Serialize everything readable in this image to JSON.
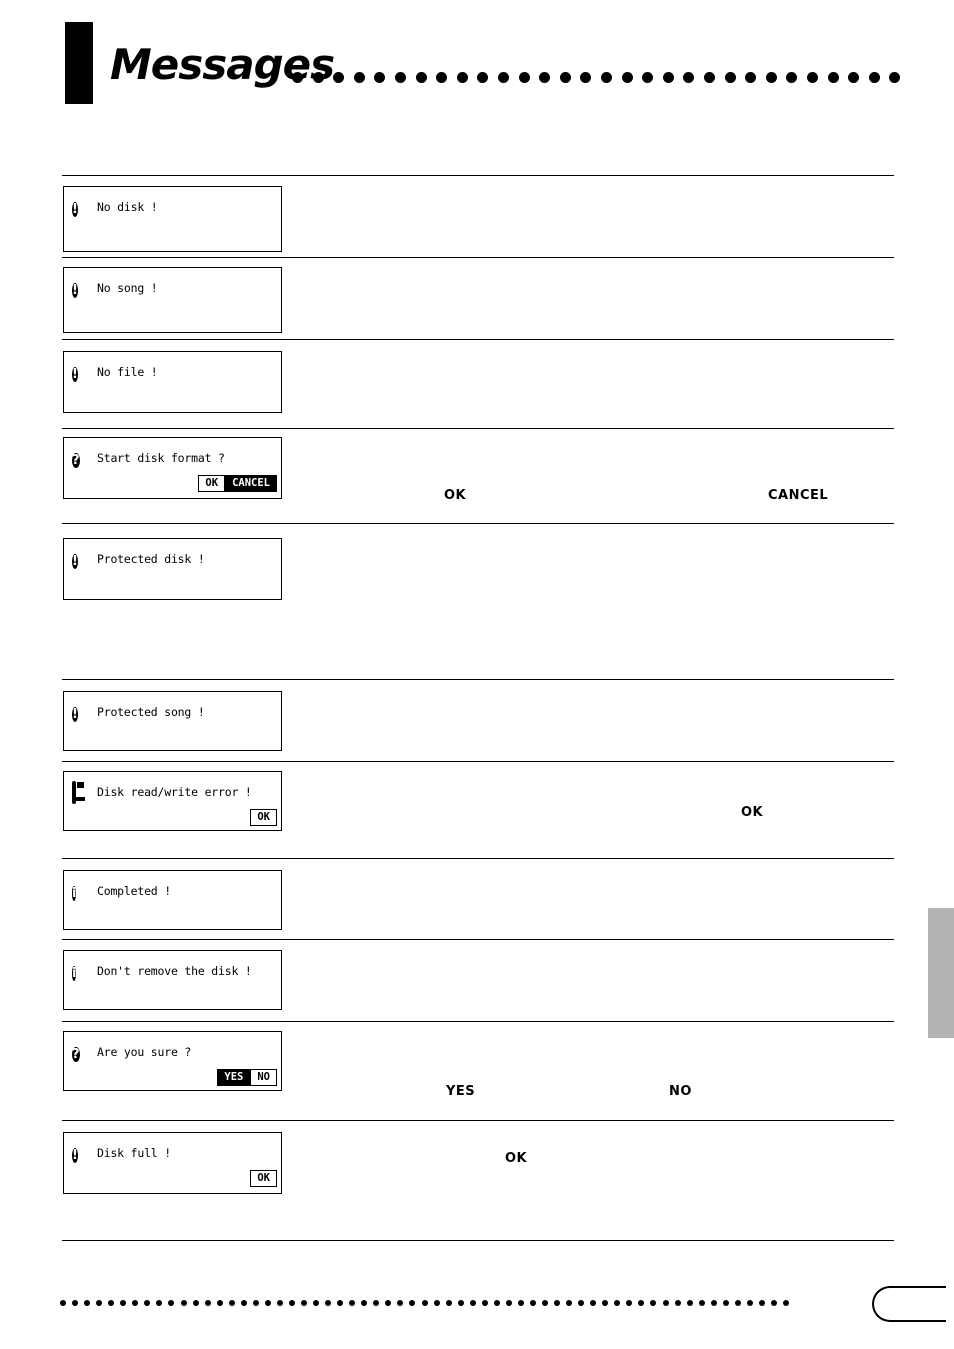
{
  "header": {
    "title": "Messages",
    "dot_count": 30
  },
  "messages": [
    {
      "id": "no-disk",
      "icon": "exclamation-icon",
      "icon_glyph": "!",
      "text": "No disk !",
      "buttons": []
    },
    {
      "id": "no-song",
      "icon": "exclamation-icon",
      "icon_glyph": "!",
      "text": "No song !",
      "buttons": []
    },
    {
      "id": "no-file",
      "icon": "exclamation-icon",
      "icon_glyph": "!",
      "text": "No file !",
      "buttons": []
    },
    {
      "id": "start-disk-format",
      "icon": "question-icon",
      "icon_glyph": "?",
      "text": "Start disk format ?",
      "buttons": [
        {
          "label": "OK",
          "inverted": false
        },
        {
          "label": "CANCEL",
          "inverted": true
        }
      ]
    },
    {
      "id": "protected-disk",
      "icon": "exclamation-icon",
      "icon_glyph": "!",
      "text": "Protected disk !",
      "buttons": []
    },
    {
      "id": "protected-song",
      "icon": "exclamation-icon",
      "icon_glyph": "!",
      "text": "Protected song !",
      "buttons": []
    },
    {
      "id": "disk-read-write-error",
      "icon": "floppy-disk-icon",
      "icon_glyph": "",
      "text": "Disk read/write error !",
      "buttons": [
        {
          "label": "OK",
          "inverted": false
        }
      ]
    },
    {
      "id": "completed",
      "icon": "information-icon",
      "icon_glyph": "i",
      "text": "Completed !",
      "buttons": []
    },
    {
      "id": "dont-remove-the-disk",
      "icon": "information-icon",
      "icon_glyph": "i",
      "text": "Don't remove the disk !",
      "buttons": []
    },
    {
      "id": "are-you-sure",
      "icon": "question-icon",
      "icon_glyph": "?",
      "text": "Are you sure ?",
      "buttons": [
        {
          "label": "YES",
          "inverted": true
        },
        {
          "label": "NO",
          "inverted": false
        }
      ]
    },
    {
      "id": "disk-full",
      "icon": "exclamation-icon",
      "icon_glyph": "!",
      "text": "Disk full !",
      "buttons": [
        {
          "label": "OK",
          "inverted": false
        }
      ]
    }
  ],
  "inline_keywords": {
    "format_ok": "OK",
    "format_cancel": "CANCEL",
    "error_ok": "OK",
    "sure_yes": "YES",
    "sure_no": "NO",
    "full_ok": "OK"
  },
  "footer": {
    "dot_count": 61
  }
}
